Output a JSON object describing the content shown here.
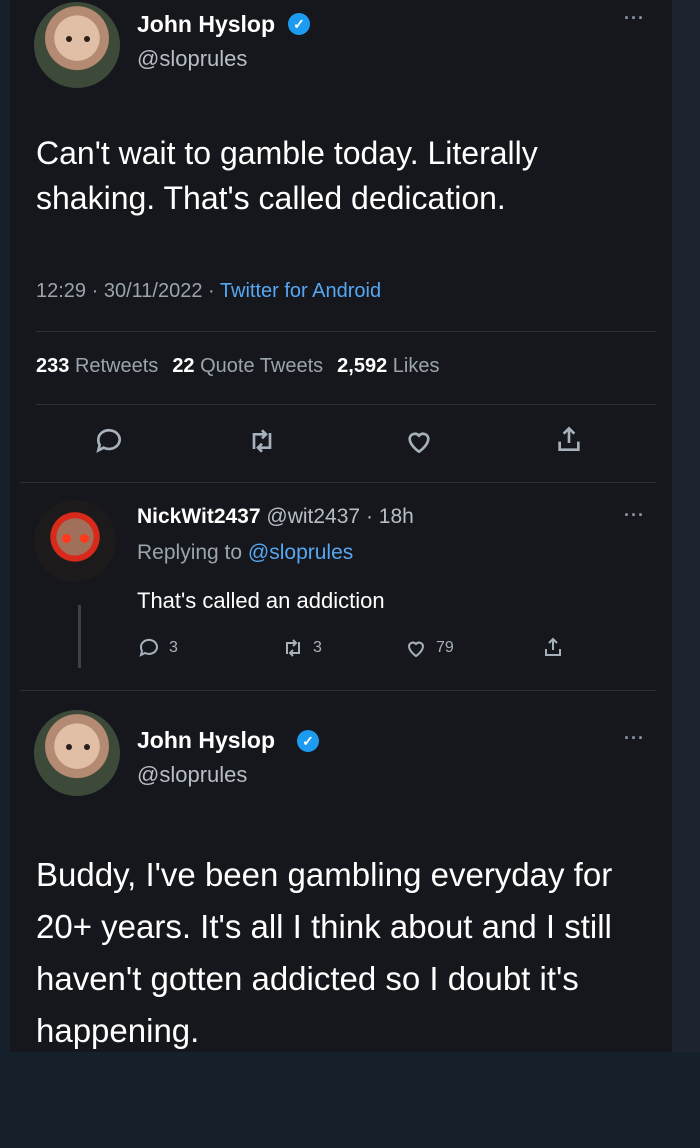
{
  "tweet": {
    "author_name": "John Hyslop",
    "author_handle": "@sloprules",
    "text": "Can't wait to gamble today. Literally shaking. That's called dedication.",
    "time": "12:29",
    "date": "30/11/2022",
    "source": "Twitter for Android",
    "stats": {
      "retweets_count": "233",
      "retweets_label": "Retweets",
      "quotes_count": "22",
      "quotes_label": "Quote Tweets",
      "likes_count": "2,592",
      "likes_label": "Likes"
    }
  },
  "reply": {
    "author_name": "NickWit2437",
    "author_handle": "@wit2437",
    "age": "18h",
    "replying_prefix": "Replying to",
    "replying_to": "@sloprules",
    "text": "That's called an addiction",
    "reply_count": "3",
    "retweet_count": "3",
    "like_count": "79"
  },
  "reply2": {
    "author_name": "John Hyslop",
    "author_handle": "@sloprules",
    "text": "Buddy, I've been gambling everyday for 20+ years. It's all I think about and I still haven't gotten addicted so I doubt it's happening."
  },
  "colors": {
    "accent": "#1d9bf0",
    "link": "#56a7f2",
    "background": "#15171c"
  }
}
